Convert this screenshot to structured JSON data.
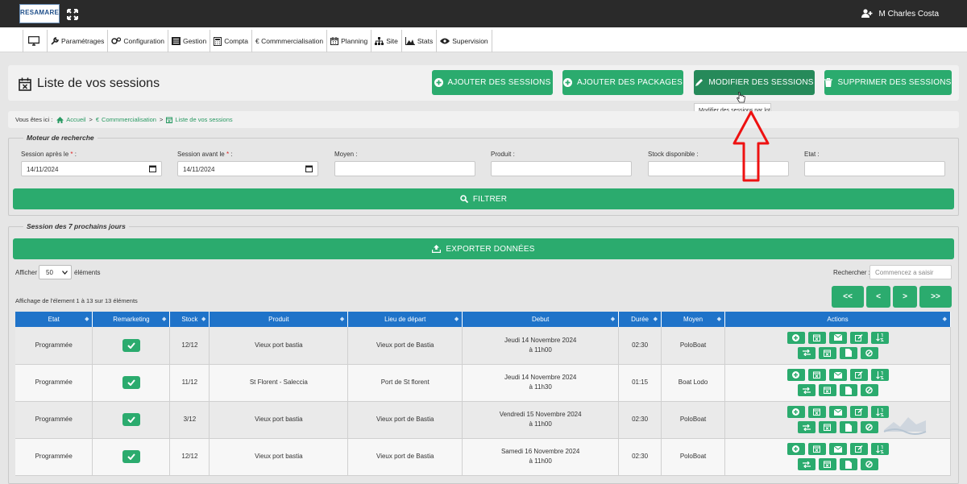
{
  "app": {
    "logo_text": "RESAMARE",
    "user_name": "M Charles Costa"
  },
  "nav": {
    "items": [
      {
        "label": "",
        "icon": "monitor-icon"
      },
      {
        "label": "Paramétrages",
        "icon": "wrench-icon"
      },
      {
        "label": "Configuration",
        "icon": "cogs-icon"
      },
      {
        "label": "Gestion",
        "icon": "list-icon"
      },
      {
        "label": "Compta",
        "icon": "calculator-icon"
      },
      {
        "label": "€ Commmercialisation",
        "icon": ""
      },
      {
        "label": "Planning",
        "icon": "calendar-icon"
      },
      {
        "label": "Site",
        "icon": "sitemap-icon"
      },
      {
        "label": "Stats",
        "icon": "chart-icon"
      },
      {
        "label": "Supervision",
        "icon": "eye-icon"
      }
    ]
  },
  "header": {
    "title": "Liste de vos sessions",
    "buttons": {
      "add_sessions": "AJOUTER DES SESSIONS",
      "add_packages": "AJOUTER DES PACKAGES",
      "modify": "MODIFIER DES SESSIONS",
      "delete": "SUPPRIMER DES SESSIONS"
    },
    "tooltip": "Modifier des sessions par lot"
  },
  "breadcrumb": {
    "prefix": "Vous êtes ici :",
    "home": "Accueil",
    "commerce": "Commmercialisation",
    "current": "Liste de vos sessions"
  },
  "search": {
    "legend": "Moteur de recherche",
    "fields": {
      "after_label": "Session après le",
      "after_value": "14/11/2024",
      "before_label": "Session avant le",
      "before_value": "14/11/2024",
      "moyen_label": "Moyen :",
      "produit_label": "Produit :",
      "stock_label": "Stock disponible :",
      "etat_label": "Etat :"
    },
    "filter_label": "FILTRER"
  },
  "sessions": {
    "legend": "Session des 7 prochains jours",
    "export_label": "EXPORTER DONNÉES",
    "show_label": "Afficher",
    "show_value": "50",
    "show_suffix": "éléments",
    "search_label": "Rechercher :",
    "search_placeholder": "Commencez a saisir",
    "info": "Affichage de l'élement 1 à 13 sur 13 éléments",
    "pagination": {
      "first": "<<",
      "prev": "<",
      "next": ">",
      "last": ">>"
    },
    "columns": [
      "Etat",
      "Remarketing",
      "Stock",
      "Produit",
      "Lieu de départ",
      "Debut",
      "Durée",
      "Moyen",
      "Actions"
    ],
    "rows": [
      {
        "etat": "Programmée",
        "stock": "12/12",
        "produit": "Vieux port bastia",
        "lieu": "Vieux port de Bastia",
        "debut1": "Jeudi 14 Novembre 2024",
        "debut2": "à 11h00",
        "duree": "02:30",
        "moyen": "PoloBoat"
      },
      {
        "etat": "Programmée",
        "stock": "11/12",
        "produit": "St Florent - Saleccia",
        "lieu": "Port de St florent",
        "debut1": "Jeudi 14 Novembre 2024",
        "debut2": "à 11h30",
        "duree": "01:15",
        "moyen": "Boat Lodo"
      },
      {
        "etat": "Programmée",
        "stock": "3/12",
        "produit": "Vieux port bastia",
        "lieu": "Vieux port de Bastia",
        "debut1": "Vendredi 15 Novembre 2024",
        "debut2": "à 11h00",
        "duree": "02:30",
        "moyen": "PoloBoat"
      },
      {
        "etat": "Programmée",
        "stock": "12/12",
        "produit": "Vieux port bastia",
        "lieu": "Vieux port de Bastia",
        "debut1": "Samedi 16 Novembre 2024",
        "debut2": "à 11h00",
        "duree": "02:30",
        "moyen": "PoloBoat"
      }
    ]
  },
  "colors": {
    "green": "#2bab6e",
    "blue": "#1f73c9",
    "dark": "#2a2a2a"
  }
}
